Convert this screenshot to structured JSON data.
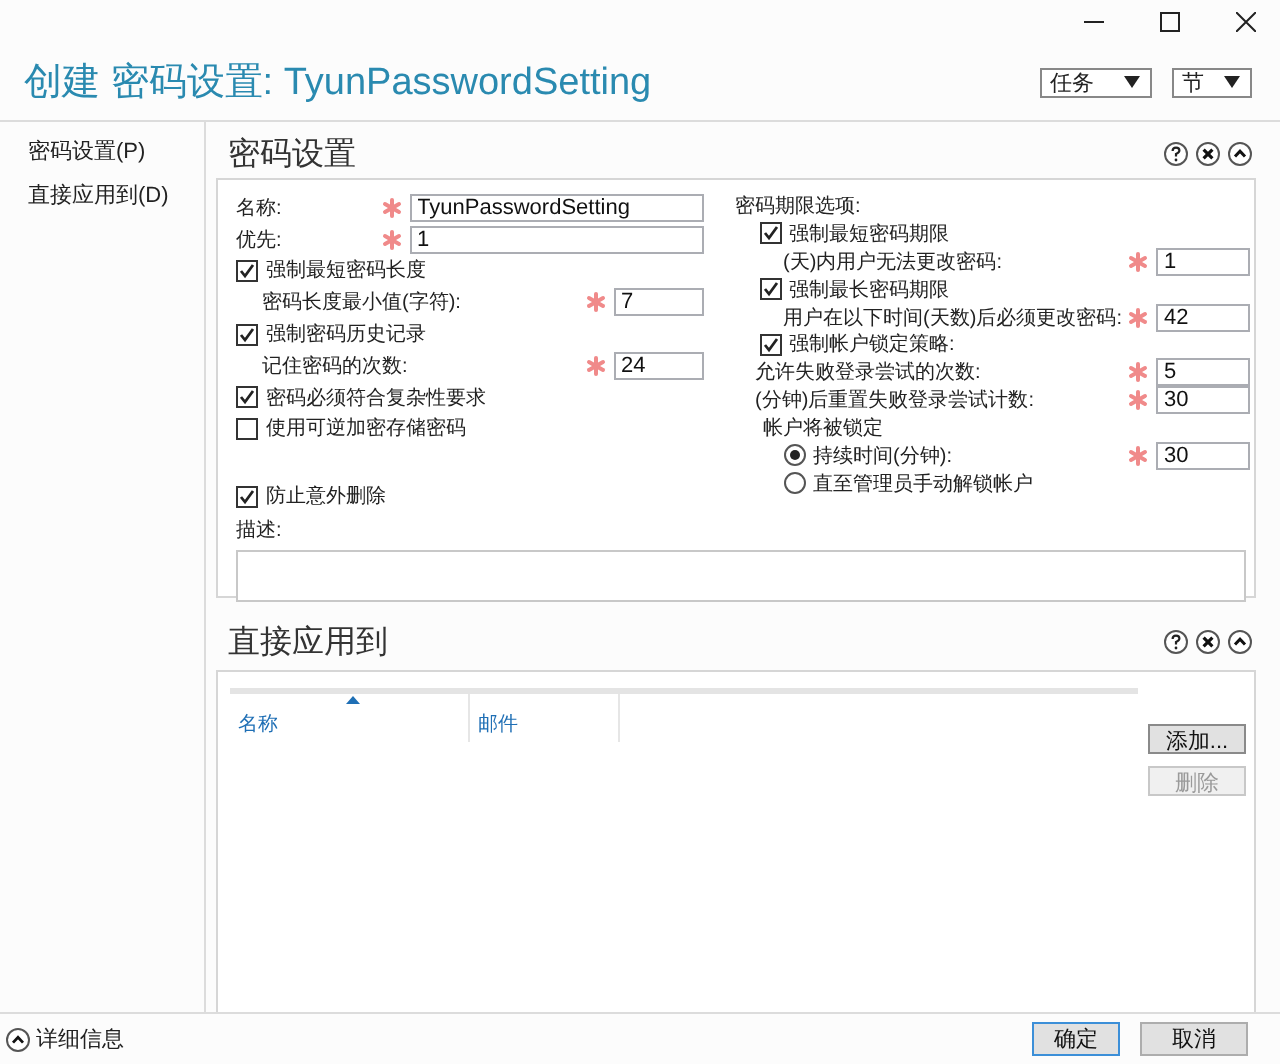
{
  "header": {
    "title": "创建 密码设置: TyunPasswordSetting",
    "menus": [
      {
        "label": "任务"
      },
      {
        "label": "节"
      }
    ]
  },
  "nav": {
    "items": [
      {
        "label": "密码设置(P)"
      },
      {
        "label": "直接应用到(D)"
      }
    ]
  },
  "password_settings": {
    "title": "密码设置",
    "general": [
      {
        "kind": "field",
        "label": "名称:",
        "value": "TyunPasswordSetting",
        "required": true
      },
      {
        "kind": "field",
        "label": "优先:",
        "value": "1",
        "required": true
      },
      {
        "kind": "checkbox",
        "label": "强制最短密码长度",
        "checked": true
      },
      {
        "kind": "subfield",
        "label": "密码长度最小值(字符):",
        "value": "7",
        "required": true
      },
      {
        "kind": "checkbox",
        "label": "强制密码历史记录",
        "checked": true
      },
      {
        "kind": "subfield",
        "label": "记住密码的次数:",
        "value": "24",
        "required": true
      },
      {
        "kind": "checkbox",
        "label": "密码必须符合复杂性要求",
        "checked": true
      },
      {
        "kind": "checkbox",
        "label": "使用可逆加密存储密码",
        "checked": false
      }
    ],
    "protect": {
      "label": "防止意外删除",
      "checked": true
    },
    "expiry": {
      "label": "密码期限选项:",
      "items": [
        {
          "kind": "checkbox",
          "label": "强制最短密码期限",
          "checked": true
        },
        {
          "kind": "subfield",
          "label": "(天)内用户无法更改密码:",
          "value": "1",
          "required": true
        },
        {
          "kind": "checkbox",
          "label": "强制最长密码期限",
          "checked": true
        },
        {
          "kind": "subfield",
          "label": "用户在以下时间(天数)后必须更改密码:",
          "value": "42",
          "required": true
        }
      ]
    },
    "lockout": {
      "label": "强制帐户锁定策略:",
      "checked": true,
      "items": [
        {
          "kind": "field",
          "label": "允许失败登录尝试的次数:",
          "value": "5",
          "required": true
        },
        {
          "kind": "field",
          "label": "(分钟)后重置失败登录尝试计数:",
          "value": "30",
          "required": true
        },
        {
          "kind": "label",
          "label": "帐户将被锁定"
        },
        {
          "kind": "radio",
          "label": "持续时间(分钟):",
          "selected": true,
          "value": "30",
          "required": true
        },
        {
          "kind": "radio",
          "label": "直至管理员手动解锁帐户",
          "selected": false
        }
      ]
    },
    "description": {
      "label": "描述:"
    }
  },
  "applies_to": {
    "title": "直接应用到",
    "columns": [
      {
        "label": "名称",
        "sorted": true
      },
      {
        "label": "邮件",
        "sorted": false
      }
    ],
    "buttons": [
      {
        "label": "添加...",
        "disabled": false
      },
      {
        "label": "删除",
        "disabled": true
      }
    ]
  },
  "footer": {
    "details": "详细信息",
    "buttons": [
      {
        "label": "确定",
        "default": true
      },
      {
        "label": "取消",
        "default": false
      }
    ]
  }
}
